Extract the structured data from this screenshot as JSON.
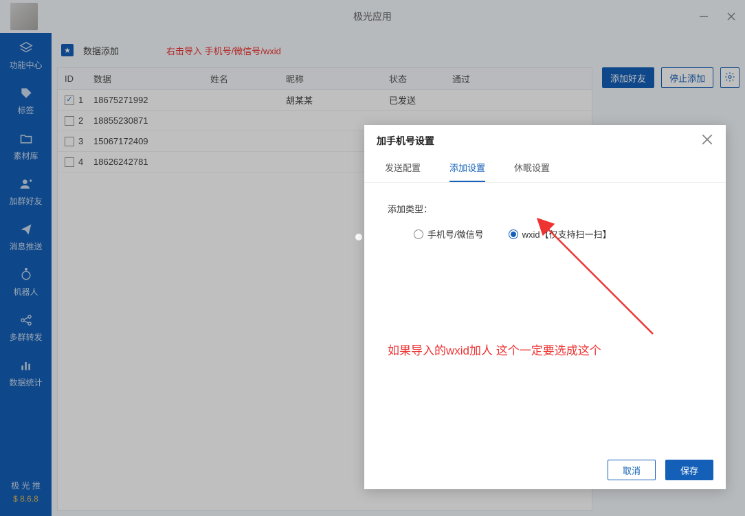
{
  "app": {
    "title": "极光应用"
  },
  "sidebar": {
    "items": [
      {
        "label": "功能中心"
      },
      {
        "label": "标签"
      },
      {
        "label": "素材库"
      },
      {
        "label": "加群好友"
      },
      {
        "label": "消息推送"
      },
      {
        "label": "机器人"
      },
      {
        "label": "多群转发"
      },
      {
        "label": "数据统计"
      }
    ],
    "footer_label": "极 光 推",
    "version": "$ 8.6.8"
  },
  "toolbar": {
    "label": "数据添加",
    "hint": "右击导入 手机号/微信号/wxid"
  },
  "table": {
    "columns": {
      "id": "ID",
      "data": "数据",
      "name": "姓名",
      "nick": "昵称",
      "status": "状态",
      "pass": "通过"
    },
    "rows": [
      {
        "id": "1",
        "data": "18675271992",
        "name": "",
        "nick": "胡某某",
        "status": "已发送",
        "pass": "",
        "checked": true
      },
      {
        "id": "2",
        "data": "18855230871",
        "name": "",
        "nick": "",
        "status": "",
        "pass": "",
        "checked": false
      },
      {
        "id": "3",
        "data": "15067172409",
        "name": "",
        "nick": "",
        "status": "",
        "pass": "",
        "checked": false
      },
      {
        "id": "4",
        "data": "18626242781",
        "name": "",
        "nick": "",
        "status": "",
        "pass": "",
        "checked": false
      }
    ]
  },
  "actions": {
    "add": "添加好友",
    "stop": "停止添加"
  },
  "modal": {
    "title": "加手机号设置",
    "tabs": [
      {
        "label": "发送配置"
      },
      {
        "label": "添加设置"
      },
      {
        "label": "休眠设置"
      }
    ],
    "field_label": "添加类型：",
    "options": [
      {
        "label": "手机号/微信号",
        "selected": false
      },
      {
        "label": "wxid【仅支持扫一扫】",
        "selected": true
      }
    ],
    "annotation": "如果导入的wxid加人 这个一定要选成这个",
    "cancel": "取消",
    "save": "保存"
  }
}
